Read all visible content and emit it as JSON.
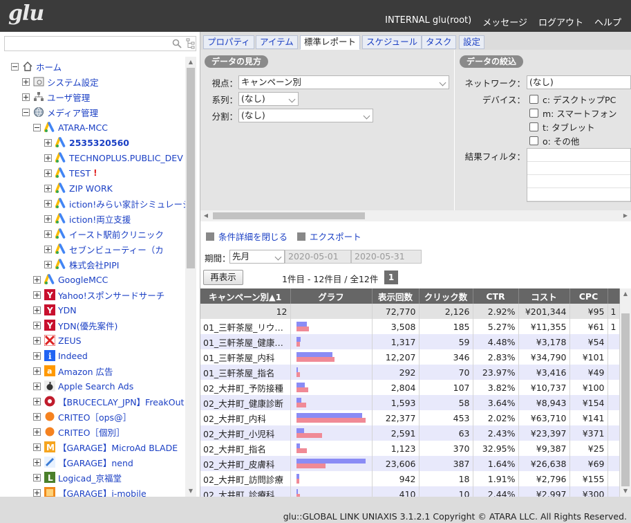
{
  "header": {
    "logo": "glu",
    "nav": [
      "INTERNAL glu(root)",
      "メッセージ",
      "ログアウト",
      "ヘルプ"
    ]
  },
  "sidebar": {
    "search_value": "",
    "tree": [
      {
        "label": "ホーム",
        "icon": "home-icon",
        "level": 0,
        "expander": "minus"
      },
      {
        "label": "システム設定",
        "icon": "system-settings-icon",
        "level": 1,
        "expander": "plus"
      },
      {
        "label": "ユーザ管理",
        "icon": "user-management-icon",
        "level": 1,
        "expander": "plus"
      },
      {
        "label": "メディア管理",
        "icon": "globe-icon",
        "level": 1,
        "expander": "minus"
      },
      {
        "label": "ATARA-MCC",
        "icon": "google-ads-icon",
        "level": 2,
        "expander": "minus"
      },
      {
        "label": "2535320560",
        "icon": "google-ads-icon",
        "level": 3,
        "expander": "plus",
        "bold": true
      },
      {
        "label": "TECHNOPLUS.PUBLIC_DEV",
        "icon": "google-ads-icon",
        "level": 3,
        "expander": "plus"
      },
      {
        "label": "TEST",
        "icon": "google-ads-icon",
        "level": 3,
        "expander": "plus",
        "suffix": "!"
      },
      {
        "label": "ZIP WORK",
        "icon": "google-ads-icon",
        "level": 3,
        "expander": "plus"
      },
      {
        "label": "iction!みらい家計シミュレーシ",
        "icon": "google-ads-icon",
        "level": 3,
        "expander": "plus"
      },
      {
        "label": "iction!両立支援",
        "icon": "google-ads-icon",
        "level": 3,
        "expander": "plus"
      },
      {
        "label": "イースト駅前クリニック",
        "icon": "google-ads-icon",
        "level": 3,
        "expander": "plus"
      },
      {
        "label": "セブンビューティー（カ",
        "icon": "google-ads-icon",
        "level": 3,
        "expander": "plus"
      },
      {
        "label": "株式会社PIPI",
        "icon": "google-ads-icon",
        "level": 3,
        "expander": "plus"
      },
      {
        "label": "GoogleMCC",
        "icon": "google-ads-icon",
        "level": 2,
        "expander": "plus"
      },
      {
        "label": "Yahoo!スポンサードサーチ",
        "icon": "yahoo-icon",
        "level": 2,
        "expander": "plus"
      },
      {
        "label": "YDN",
        "icon": "yahoo-icon",
        "level": 2,
        "expander": "plus"
      },
      {
        "label": "YDN(優先案件)",
        "icon": "yahoo-icon",
        "level": 2,
        "expander": "plus"
      },
      {
        "label": "ZEUS",
        "icon": "zeus-icon",
        "level": 2,
        "expander": "plus"
      },
      {
        "label": "Indeed",
        "icon": "indeed-icon",
        "level": 2,
        "expander": "plus"
      },
      {
        "label": "Amazon 広告",
        "icon": "amazon-icon",
        "level": 2,
        "expander": "plus"
      },
      {
        "label": "Apple Search Ads",
        "icon": "apple-icon",
        "level": 2,
        "expander": "plus"
      },
      {
        "label": "【BRUCECLAY_JPN】FreakOut",
        "icon": "freakout-icon",
        "level": 2,
        "expander": "plus"
      },
      {
        "label": "CRITEO［ops@］",
        "icon": "criteo-icon",
        "level": 2,
        "expander": "plus"
      },
      {
        "label": "CRITEO［個別］",
        "icon": "criteo-icon",
        "level": 2,
        "expander": "plus"
      },
      {
        "label": "【GARAGE】MicroAd BLADE",
        "icon": "microad-icon",
        "level": 2,
        "expander": "plus"
      },
      {
        "label": "【GARAGE】nend",
        "icon": "nend-icon",
        "level": 2,
        "expander": "plus"
      },
      {
        "label": "Logicad_京福堂",
        "icon": "logicad-icon",
        "level": 2,
        "expander": "plus"
      },
      {
        "label": "【GARAGE】i-mobile",
        "icon": "imobile-icon",
        "level": 2,
        "expander": "plus"
      }
    ]
  },
  "tabs": [
    "プロパティ",
    "アイテム",
    "標準レポート",
    "スケジュール",
    "タスク",
    "設定"
  ],
  "active_tab": "標準レポート",
  "view_section": {
    "title": "データの見方",
    "fields": [
      {
        "label": "視点：",
        "value": "キャンペーン別"
      },
      {
        "label": "系列：",
        "value": "(なし)"
      },
      {
        "label": "分割：",
        "value": "(なし)"
      }
    ]
  },
  "filter_section": {
    "title": "データの絞込",
    "network_label": "ネットワーク：",
    "network_value": "(なし)",
    "device_label": "デバイス：",
    "devices": [
      "c: デスクトップPC",
      "m: スマートフォン",
      "t: タブレット",
      "o: その他"
    ],
    "result_filter_label": "結果フィルタ："
  },
  "toolbar": {
    "close_details": "条件詳細を閉じる",
    "export": "エクスポート"
  },
  "period": {
    "label": "期間：",
    "value": "先月",
    "start": "2020-05-01",
    "end": "2020-05-31"
  },
  "redisplay_label": "再表示",
  "count_info": "1件目 - 12件目 / 全12件",
  "page": "1",
  "table": {
    "headers": [
      "キャンペーン別▲1",
      "グラフ",
      "表示回数",
      "クリック数",
      "CTR",
      "コスト",
      "CPC"
    ],
    "summary": {
      "label": "12",
      "impressions": "72,770",
      "clicks": "2,126",
      "ctr": "2.92%",
      "cost": "¥201,344",
      "cpc": "¥95",
      "extra": "1"
    },
    "rows": [
      {
        "name": "01_三軒茶屋_リウ…",
        "impressions": "3,508",
        "clicks": "185",
        "ctr": "5.27%",
        "cost": "¥11,355",
        "cpc": "¥61",
        "extra": "1",
        "bar_impressions": 3508,
        "bar_cost": 11355
      },
      {
        "name": "01_三軒茶屋_健康…",
        "impressions": "1,317",
        "clicks": "59",
        "ctr": "4.48%",
        "cost": "¥3,178",
        "cpc": "¥54",
        "extra": "",
        "bar_impressions": 1317,
        "bar_cost": 3178
      },
      {
        "name": "01_三軒茶屋_内科",
        "impressions": "12,207",
        "clicks": "346",
        "ctr": "2.83%",
        "cost": "¥34,790",
        "cpc": "¥101",
        "extra": "",
        "bar_impressions": 12207,
        "bar_cost": 34790
      },
      {
        "name": "01_三軒茶屋_指名",
        "impressions": "292",
        "clicks": "70",
        "ctr": "23.97%",
        "cost": "¥3,416",
        "cpc": "¥49",
        "extra": "",
        "bar_impressions": 292,
        "bar_cost": 3416
      },
      {
        "name": "02_大井町_予防接種",
        "impressions": "2,804",
        "clicks": "107",
        "ctr": "3.82%",
        "cost": "¥10,737",
        "cpc": "¥100",
        "extra": "",
        "bar_impressions": 2804,
        "bar_cost": 10737
      },
      {
        "name": "02_大井町_健康診断",
        "impressions": "1,593",
        "clicks": "58",
        "ctr": "3.64%",
        "cost": "¥8,943",
        "cpc": "¥154",
        "extra": "",
        "bar_impressions": 1593,
        "bar_cost": 8943
      },
      {
        "name": "02_大井町_内科",
        "impressions": "22,377",
        "clicks": "453",
        "ctr": "2.02%",
        "cost": "¥63,710",
        "cpc": "¥141",
        "extra": "",
        "bar_impressions": 22377,
        "bar_cost": 63710
      },
      {
        "name": "02_大井町_小児科",
        "impressions": "2,591",
        "clicks": "63",
        "ctr": "2.43%",
        "cost": "¥23,397",
        "cpc": "¥371",
        "extra": "",
        "bar_impressions": 2591,
        "bar_cost": 23397
      },
      {
        "name": "02_大井町_指名",
        "impressions": "1,123",
        "clicks": "370",
        "ctr": "32.95%",
        "cost": "¥9,387",
        "cpc": "¥25",
        "extra": "",
        "bar_impressions": 1123,
        "bar_cost": 9387
      },
      {
        "name": "02_大井町_皮膚科",
        "impressions": "23,606",
        "clicks": "387",
        "ctr": "1.64%",
        "cost": "¥26,638",
        "cpc": "¥69",
        "extra": "",
        "bar_impressions": 23606,
        "bar_cost": 26638
      },
      {
        "name": "02_大井町_訪問診療",
        "impressions": "942",
        "clicks": "18",
        "ctr": "1.91%",
        "cost": "¥2,796",
        "cpc": "¥155",
        "extra": "",
        "bar_impressions": 942,
        "bar_cost": 2796
      },
      {
        "name": "02_大井町_診療科…",
        "impressions": "410",
        "clicks": "10",
        "ctr": "2.44%",
        "cost": "¥2,997",
        "cpc": "¥300",
        "extra": "",
        "bar_impressions": 410,
        "bar_cost": 2997
      }
    ]
  },
  "footer": "glu::GLOBAL LINK UNIAXIS 3.1.2.1 Copyright © ATARA LLC. All Rights Reserved.",
  "colors": {
    "header_bg": "#3b3b3b",
    "link": "#1a3fc4",
    "bar_impressions": "#8a8cf5",
    "bar_cost": "#f08a96",
    "table_header": "#666666",
    "row_alt": "#e8e9fb"
  }
}
